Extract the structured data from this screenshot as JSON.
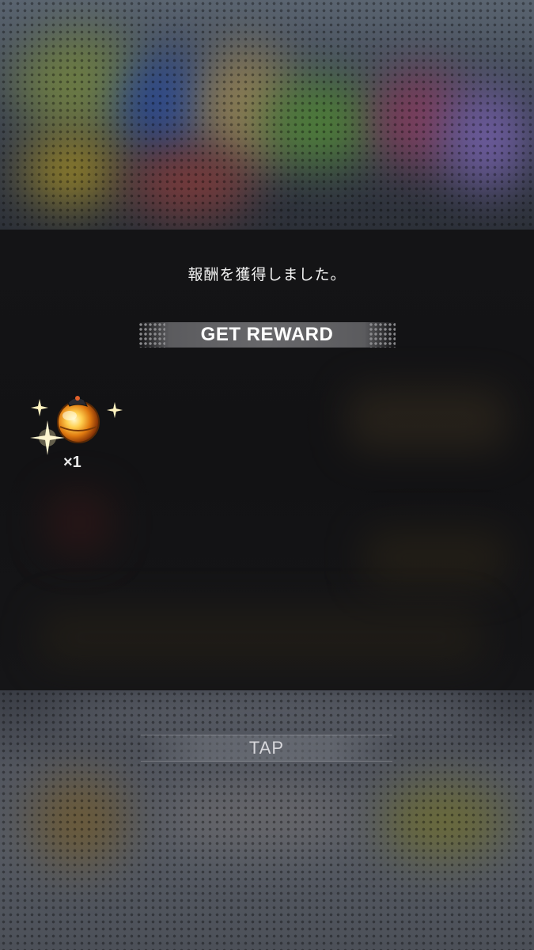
{
  "modal": {
    "message": "報酬を獲得しました。",
    "banner_title": "GET REWARD"
  },
  "reward_item": {
    "icon": "orange-orb-icon",
    "quantity": "×1"
  },
  "tap_prompt": {
    "label": "TAP"
  },
  "colors": {
    "modal_bg": "#131315",
    "banner_bg": "#646467",
    "orb_orange": "#f0a020",
    "sparkle": "#fff3c0"
  }
}
